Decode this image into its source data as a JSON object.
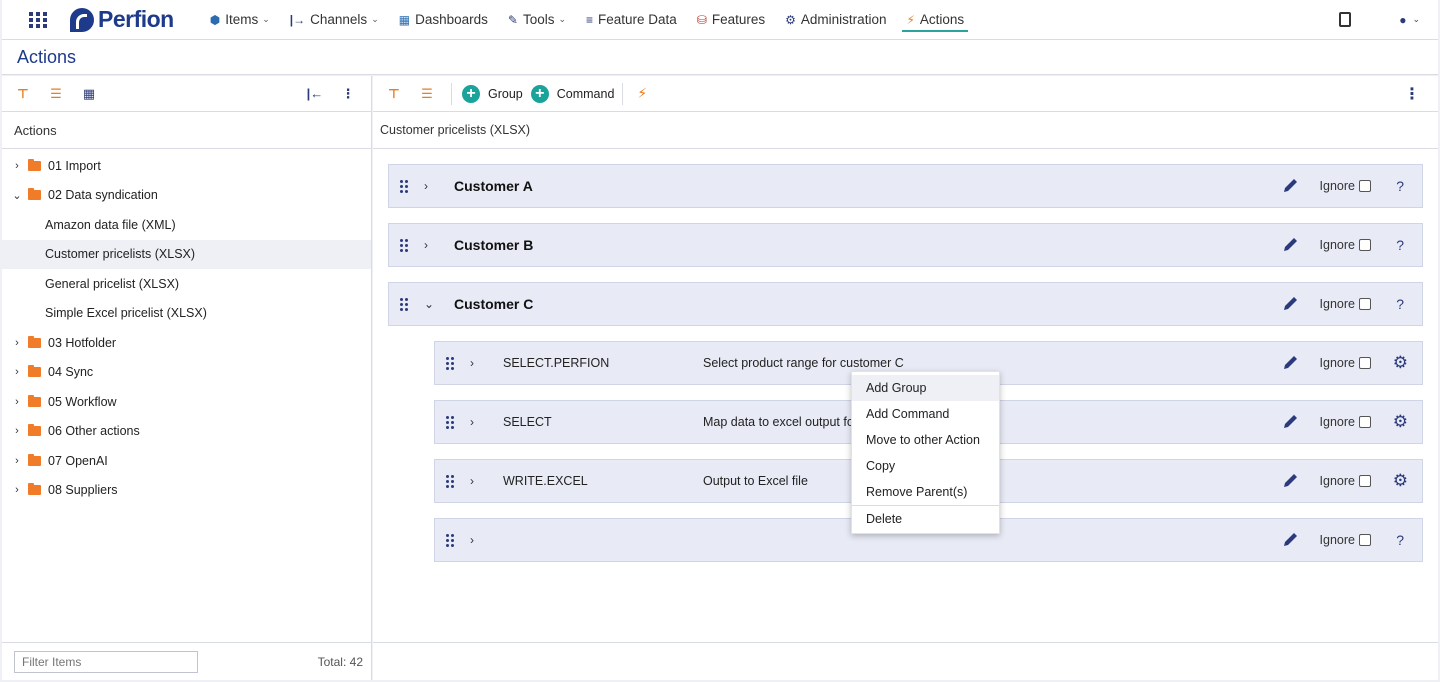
{
  "nav": {
    "logo": "Perfion",
    "items": [
      {
        "label": "Items",
        "caret": true,
        "icon": "⬢"
      },
      {
        "label": "Channels",
        "caret": true,
        "icon": "|→"
      },
      {
        "label": "Dashboards",
        "caret": false,
        "icon": "▦"
      },
      {
        "label": "Tools",
        "caret": true,
        "icon": "🔧"
      },
      {
        "label": "Feature Data",
        "caret": false,
        "icon": "≡"
      },
      {
        "label": "Features",
        "caret": false,
        "icon": "⛁"
      },
      {
        "label": "Administration",
        "caret": false,
        "icon": "⚙"
      },
      {
        "label": "Actions",
        "caret": false,
        "icon": "⚡",
        "active": true
      }
    ]
  },
  "page": {
    "title": "Actions"
  },
  "left": {
    "header": "Actions",
    "tree": [
      {
        "label": "01 Import",
        "type": "folder",
        "expanded": false
      },
      {
        "label": "02 Data syndication",
        "type": "folder",
        "expanded": true
      },
      {
        "label": "Amazon data file (XML)",
        "type": "leaf"
      },
      {
        "label": "Customer pricelists (XLSX)",
        "type": "leaf",
        "selected": true
      },
      {
        "label": "General pricelist (XLSX)",
        "type": "leaf"
      },
      {
        "label": "Simple Excel pricelist (XLSX)",
        "type": "leaf"
      },
      {
        "label": "03 Hotfolder",
        "type": "folder",
        "expanded": false
      },
      {
        "label": "04 Sync",
        "type": "folder",
        "expanded": false
      },
      {
        "label": "05 Workflow",
        "type": "folder",
        "expanded": false
      },
      {
        "label": "06 Other actions",
        "type": "folder",
        "expanded": false
      },
      {
        "label": "07 OpenAI",
        "type": "folder",
        "expanded": false
      },
      {
        "label": "08 Suppliers",
        "type": "folder",
        "expanded": false
      }
    ],
    "filter_placeholder": "Filter Items",
    "total": "Total: 42"
  },
  "right": {
    "toolbar": {
      "group_label": "Group",
      "command_label": "Command"
    },
    "header": "Customer pricelists (XLSX)",
    "ignore_label": "Ignore",
    "groups": [
      {
        "title": "Customer A",
        "expanded": false
      },
      {
        "title": "Customer B",
        "expanded": false
      },
      {
        "title": "Customer C",
        "expanded": true
      }
    ],
    "commands": [
      {
        "command": "SELECT.PERFION",
        "description": "Select product range for customer C",
        "icon": "gear"
      },
      {
        "command": "SELECT",
        "description": "Map data to excel output format",
        "icon": "gear"
      },
      {
        "command": "WRITE.EXCEL",
        "description": "Output to Excel file",
        "icon": "gear"
      },
      {
        "command": "",
        "description": "",
        "icon": "question"
      }
    ]
  },
  "context_menu": {
    "items": [
      "Add Group",
      "Add Command",
      "Move to other Action",
      "Copy",
      "Remove Parent(s)"
    ],
    "danger_item": "Delete"
  }
}
